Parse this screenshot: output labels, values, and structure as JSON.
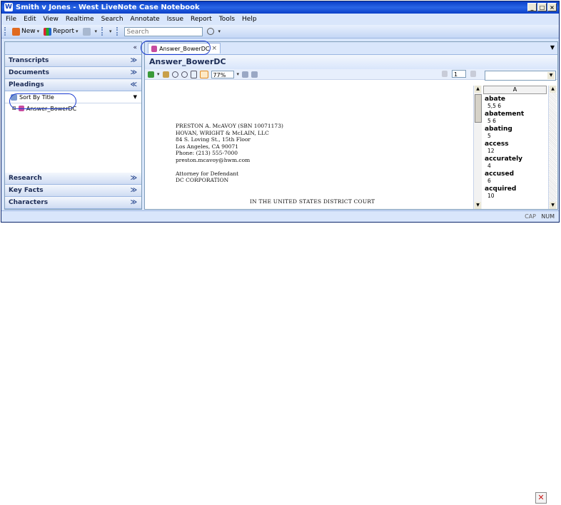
{
  "window": {
    "title": "Smith v Jones - West LiveNote Case Notebook",
    "app_icon": "W"
  },
  "menu": [
    "File",
    "Edit",
    "View",
    "Realtime",
    "Search",
    "Annotate",
    "Issue",
    "Report",
    "Tools",
    "Help"
  ],
  "toolbar": {
    "new_label": "New",
    "report_label": "Report",
    "search_placeholder": "Search"
  },
  "left_pane": {
    "sections_top": [
      "Transcripts",
      "Documents",
      "Pleadings"
    ],
    "sort_label": "Sort By Title",
    "tree_item": "Answer_BowerDC",
    "sections_bottom": [
      "Research",
      "Key Facts",
      "Characters"
    ]
  },
  "right_pane": {
    "tab_label": "Answer_BowerDC",
    "doc_title": "Answer_BowerDC",
    "zoom": "77%",
    "page": "1"
  },
  "document": {
    "lines": [
      "PRESTON A. McAVOY (SBN 10071173)",
      "HOVAN, WRIGHT & McLAIN, LLC",
      "84 S. Loving St., 15th Floor",
      "Los Angeles, CA 90071",
      "Phone: (213) 555-7000",
      "preston.mcavoy@hwm.com",
      "",
      "Attorney for Defendant",
      "DC CORPORATION"
    ],
    "court": "IN THE UNITED STATES DISTRICT COURT"
  },
  "word_index": {
    "header": "A",
    "entries": [
      {
        "term": "abate",
        "pages": "5,5 6"
      },
      {
        "term": "abatement",
        "pages": "5 6"
      },
      {
        "term": "abating",
        "pages": "5"
      },
      {
        "term": "access",
        "pages": "12"
      },
      {
        "term": "accurately",
        "pages": "4"
      },
      {
        "term": "accused",
        "pages": "6"
      },
      {
        "term": "acquired",
        "pages": "10"
      }
    ]
  },
  "status": {
    "cap": "CAP",
    "num": "NUM"
  },
  "close_glyph": "✕"
}
